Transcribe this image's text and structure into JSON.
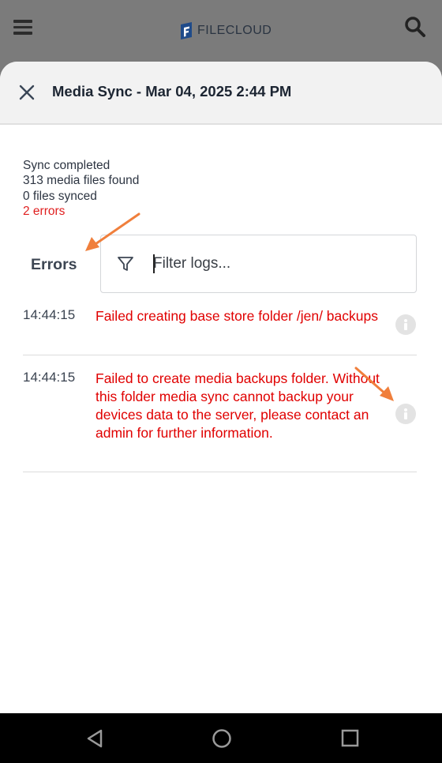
{
  "app": {
    "brand": "FILECLOUD",
    "colors": {
      "error": "#e00000",
      "appbar": "#7b7b7b",
      "annotation_arrow": "#f07f3c"
    }
  },
  "appbar": {
    "menu_icon": "hamburger-menu-icon",
    "search_icon": "search-icon"
  },
  "sheet": {
    "close_icon": "close-icon",
    "title": "Media Sync - Mar 04, 2025 2:44 PM"
  },
  "summary": {
    "status": "Sync completed",
    "found": "313 media files found",
    "synced": "0 files synced",
    "errors": "2 errors"
  },
  "logs": {
    "section_label": "Errors",
    "filter_placeholder": "Filter logs...",
    "filter_icon": "filter-icon",
    "entries": [
      {
        "time": "14:44:15",
        "message": "Failed creating base store folder /jen/ backups",
        "icon": "info-icon"
      },
      {
        "time": "14:44:15",
        "message": "Failed to create media backups folder. Without this folder media sync cannot backup your devices data to the server, please contact an admin for further information.",
        "icon": "info-icon"
      }
    ]
  },
  "navbar": {
    "back_icon": "back-triangle-icon",
    "home_icon": "home-circle-icon",
    "recents_icon": "recents-square-icon"
  }
}
